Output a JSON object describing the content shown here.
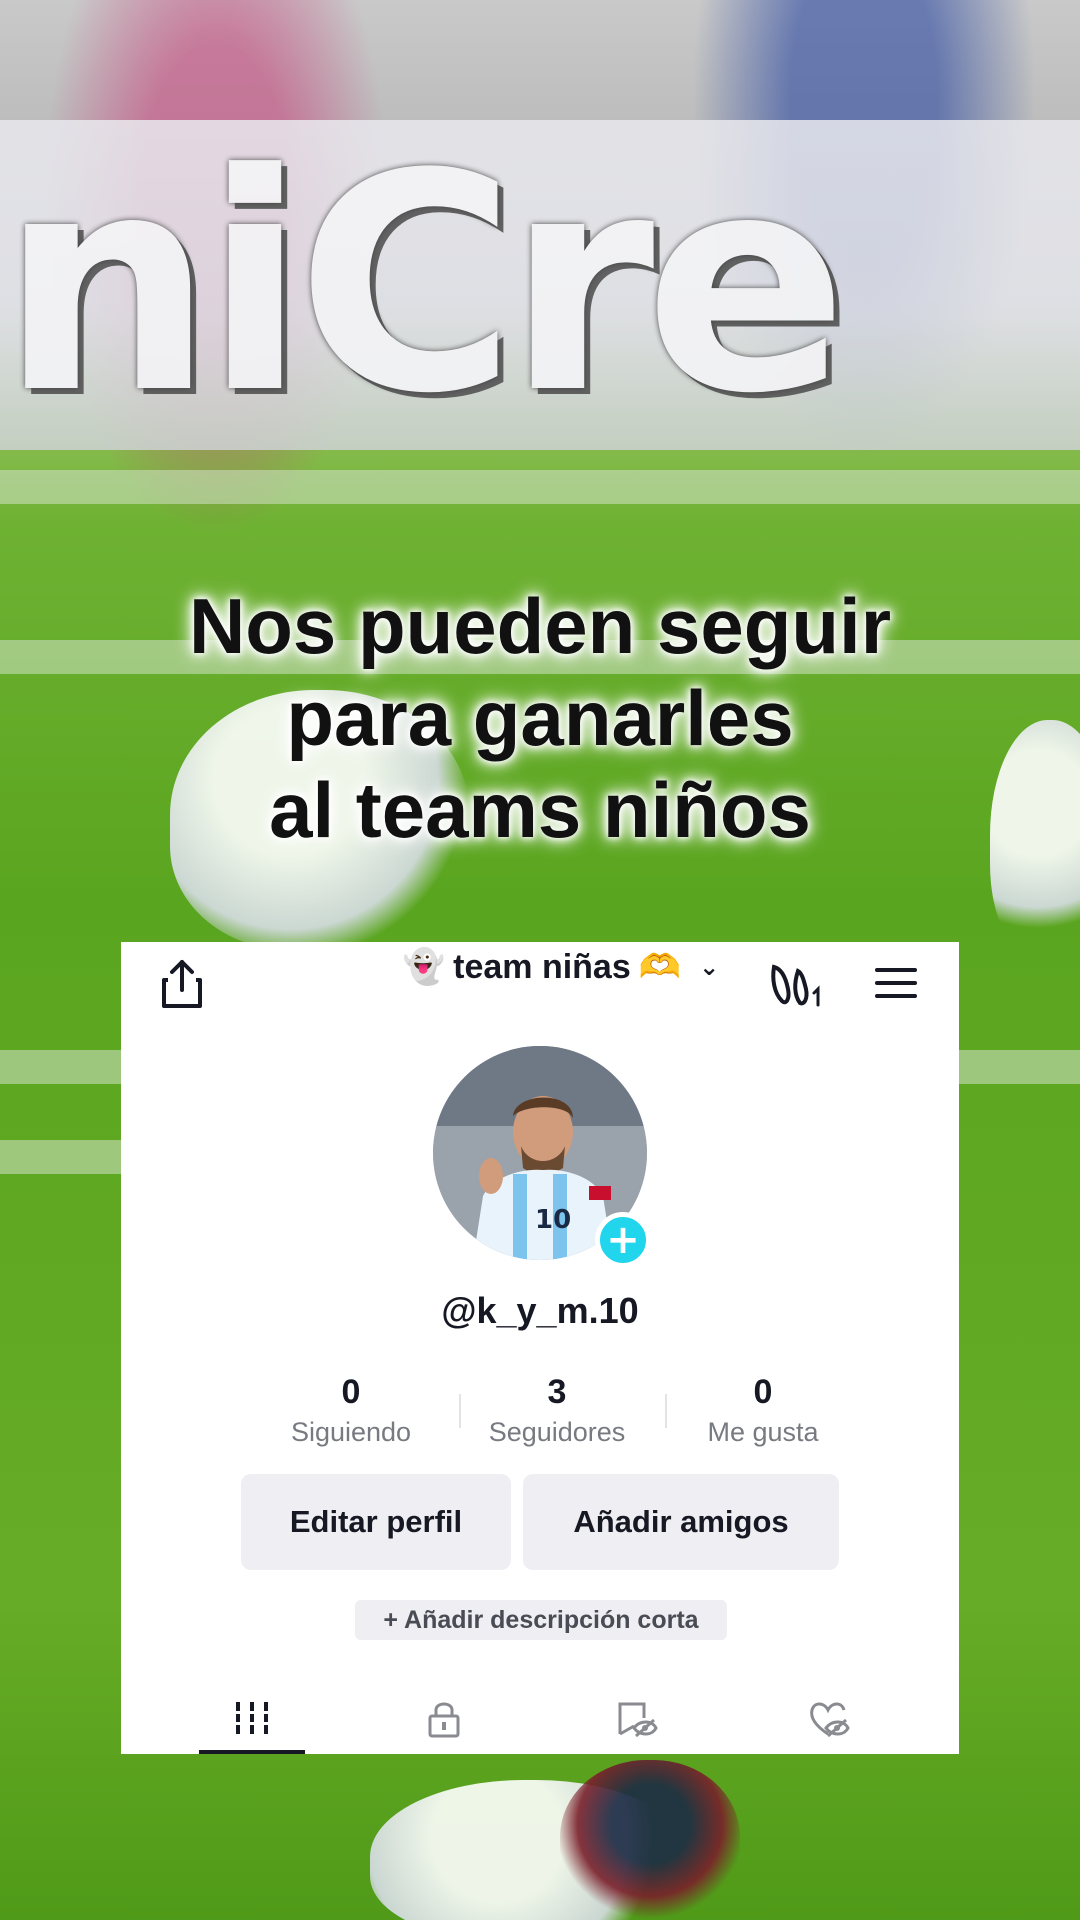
{
  "background": {
    "caption_lines": [
      "Nos pueden seguir",
      "para ganarles",
      "al teams niños"
    ]
  },
  "profile": {
    "header": {
      "share_icon": "share-icon",
      "account_name": "team niñas",
      "account_emoji_prefix": "👻",
      "account_emoji_suffix": "🫶",
      "chevron": "⌄",
      "vs_icon": "versus-icon",
      "menu_icon": "hamburger-menu-icon"
    },
    "avatar": {
      "add_label": "+"
    },
    "username": "@k_y_m.10",
    "stats": [
      {
        "value": "0",
        "label": "Siguiendo"
      },
      {
        "value": "3",
        "label": "Seguidores"
      },
      {
        "value": "0",
        "label": "Me gusta"
      }
    ],
    "buttons": {
      "edit_profile": "Editar perfil",
      "add_friends": "Añadir amigos",
      "add_bio": "+ Añadir descripción corta"
    },
    "tabs": [
      {
        "icon": "videos-grid-icon",
        "active": true
      },
      {
        "icon": "private-lock-icon",
        "active": false
      },
      {
        "icon": "reposts-hidden-icon",
        "active": false
      },
      {
        "icon": "liked-hidden-icon",
        "active": false
      }
    ],
    "colors": {
      "accent": "#20d5ec",
      "text": "#161823",
      "muted": "#777a80",
      "button_bg": "#efeef2"
    }
  }
}
